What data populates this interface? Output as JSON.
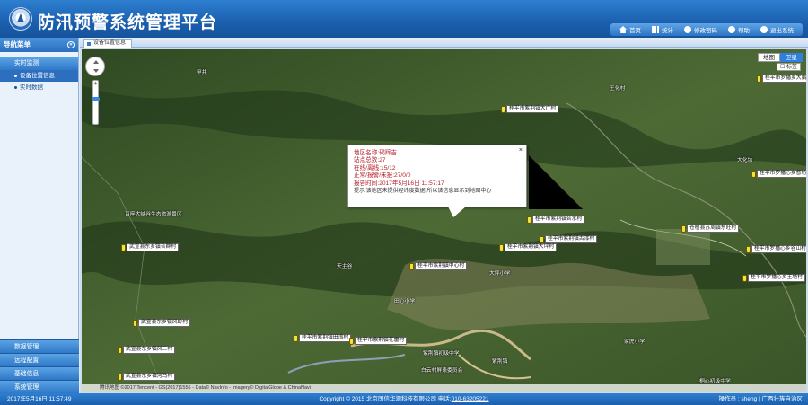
{
  "header": {
    "title": "防汛预警系统管理平台",
    "nav": [
      {
        "label": "首页",
        "icon": "home-icon"
      },
      {
        "label": "统计",
        "icon": "stats-icon"
      },
      {
        "label": "修改密码",
        "icon": "key-icon"
      },
      {
        "label": "帮助",
        "icon": "help-icon"
      },
      {
        "label": "退出系统",
        "icon": "power-icon"
      }
    ]
  },
  "sidebar": {
    "title": "导航菜单",
    "section": "实时监测",
    "items": [
      {
        "label": "设备位置信息",
        "active": true
      },
      {
        "label": "实时数据",
        "active": false
      }
    ],
    "bottom": [
      "数据管理",
      "远程配置",
      "基础信息",
      "系统管理"
    ]
  },
  "tab": {
    "label": "设备位置信息"
  },
  "map": {
    "types": [
      "地图",
      "卫星"
    ],
    "active_type": "卫星",
    "labels_toggle": "标签",
    "attribution": "©2017 Tencent - GS(2017)1556 - Data© NavInfo - Imagery© DigitalGlobe & ChinaNavi",
    "logo": "腾讯地图",
    "popup": {
      "close": "×",
      "lines": [
        "地区名称:碣蹄吉",
        "站点总数:27",
        "在线/离线:15/12",
        "正常/报警/未报:27/0/0",
        "报告时间:2017年5月16日 11:57:17"
      ],
      "hint": "提示:该地区未提供经纬度数据,所以该信息显示到地图中心"
    },
    "markers": [
      {
        "label": "桂平市紫荆镇大广村"
      },
      {
        "label": "桂平市紫荆镇合水村"
      },
      {
        "label": "桂平市紫荆镇古漆村"
      },
      {
        "label": "桂平市紫荆镇大坪村"
      },
      {
        "label": "桂平市紫荆镇中心村"
      },
      {
        "label": "武宣县东乡镇合群村"
      },
      {
        "label": "武宣县东乡镇风岭村"
      },
      {
        "label": "武宣县东乡镇风三村"
      },
      {
        "label": "武宣县东乡镇河马村"
      },
      {
        "label": "桂平市紫荆镇田湾村"
      },
      {
        "label": "桂平市紫荆镇花雷村"
      },
      {
        "label": "桂平市罗播乡大鹏镇村"
      },
      {
        "label": "桂平市罗播心乡督坊村"
      },
      {
        "label": "苍梧县苏周镇东旺村"
      },
      {
        "label": "桂平市罗播心乡谷山村"
      },
      {
        "label": "桂平市罗播心乡王塘村"
      }
    ],
    "places": [
      "百座大峡谷生态旅游景区",
      "天主谷",
      "田心小学",
      "大坪小学",
      "紫荆镇初级中学",
      "紫荆镇",
      "白云村屏患委员会",
      "王化村",
      "大化坊",
      "家虎小学",
      "桐心初级中学",
      "甲井"
    ]
  },
  "footer": {
    "time": "2017年5月16日 11:57:49",
    "copyright": "Copyright © 2015 北京国信华源科技有限公司 电话:",
    "phone": "010-63205221",
    "user": "操作员 : sheng | 广西壮族自治区"
  },
  "colors": {
    "header": "#1b5fae",
    "popup_text": "#b3202a",
    "pin": "#f3e23a"
  }
}
